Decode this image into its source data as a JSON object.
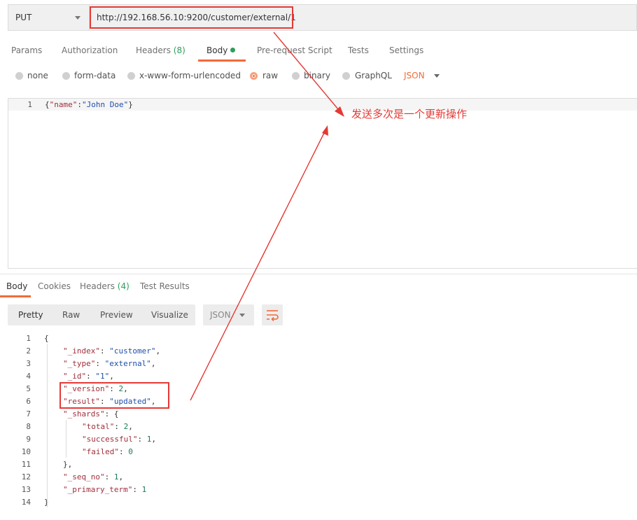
{
  "request": {
    "method": "PUT",
    "url": "http://192.168.56.10:9200/customer/external/1"
  },
  "request_tabs": {
    "params": "Params",
    "authorization": "Authorization",
    "headers": "Headers",
    "headers_count": "(8)",
    "body": "Body",
    "pre_request": "Pre-request Script",
    "tests": "Tests",
    "settings": "Settings"
  },
  "body_types": {
    "none": "none",
    "form_data": "form-data",
    "urlencoded": "x-www-form-urlencoded",
    "raw": "raw",
    "binary": "binary",
    "graphql": "GraphQL",
    "format": "JSON"
  },
  "request_body": {
    "line_number": "1",
    "open": "{",
    "key": "\"name\"",
    "colon": ":",
    "value": "\"John Doe\"",
    "close": "}"
  },
  "annotation": "发送多次是一个更新操作",
  "response_tabs": {
    "body": "Body",
    "cookies": "Cookies",
    "headers": "Headers",
    "headers_count": "(4)",
    "test_results": "Test Results"
  },
  "response_toolbar": {
    "pretty": "Pretty",
    "raw": "Raw",
    "preview": "Preview",
    "visualize": "Visualize",
    "format": "JSON"
  },
  "response_lines": [
    {
      "n": "1",
      "key": "",
      "sep": "",
      "val": "",
      "end": "{",
      "vtype": "punc",
      "indent": 0
    },
    {
      "n": "2",
      "key": "\"_index\"",
      "sep": ": ",
      "val": "\"customer\"",
      "end": ",",
      "vtype": "str",
      "indent": 1
    },
    {
      "n": "3",
      "key": "\"_type\"",
      "sep": ": ",
      "val": "\"external\"",
      "end": ",",
      "vtype": "str",
      "indent": 1
    },
    {
      "n": "4",
      "key": "\"_id\"",
      "sep": ": ",
      "val": "\"1\"",
      "end": ",",
      "vtype": "str",
      "indent": 1
    },
    {
      "n": "5",
      "key": "\"_version\"",
      "sep": ": ",
      "val": "2",
      "end": ",",
      "vtype": "num",
      "indent": 1
    },
    {
      "n": "6",
      "key": "\"result\"",
      "sep": ": ",
      "val": "\"updated\"",
      "end": ",",
      "vtype": "str",
      "indent": 1
    },
    {
      "n": "7",
      "key": "\"_shards\"",
      "sep": ": ",
      "val": "",
      "end": "{",
      "vtype": "punc",
      "indent": 1
    },
    {
      "n": "8",
      "key": "\"total\"",
      "sep": ": ",
      "val": "2",
      "end": ",",
      "vtype": "num",
      "indent": 2
    },
    {
      "n": "9",
      "key": "\"successful\"",
      "sep": ": ",
      "val": "1",
      "end": ",",
      "vtype": "num",
      "indent": 2
    },
    {
      "n": "10",
      "key": "\"failed\"",
      "sep": ": ",
      "val": "0",
      "end": "",
      "vtype": "num",
      "indent": 2
    },
    {
      "n": "11",
      "key": "",
      "sep": "",
      "val": "",
      "end": "},",
      "vtype": "punc",
      "indent": 1
    },
    {
      "n": "12",
      "key": "\"_seq_no\"",
      "sep": ": ",
      "val": "1",
      "end": ",",
      "vtype": "num",
      "indent": 1
    },
    {
      "n": "13",
      "key": "\"_primary_term\"",
      "sep": ": ",
      "val": "1",
      "end": "",
      "vtype": "num",
      "indent": 1
    },
    {
      "n": "14",
      "key": "",
      "sep": "",
      "val": "",
      "end": "}",
      "vtype": "punc",
      "indent": 0
    }
  ],
  "colors": {
    "accent": "#f26b3a",
    "annotation_red": "#e53935",
    "green": "#2e9e5b"
  }
}
